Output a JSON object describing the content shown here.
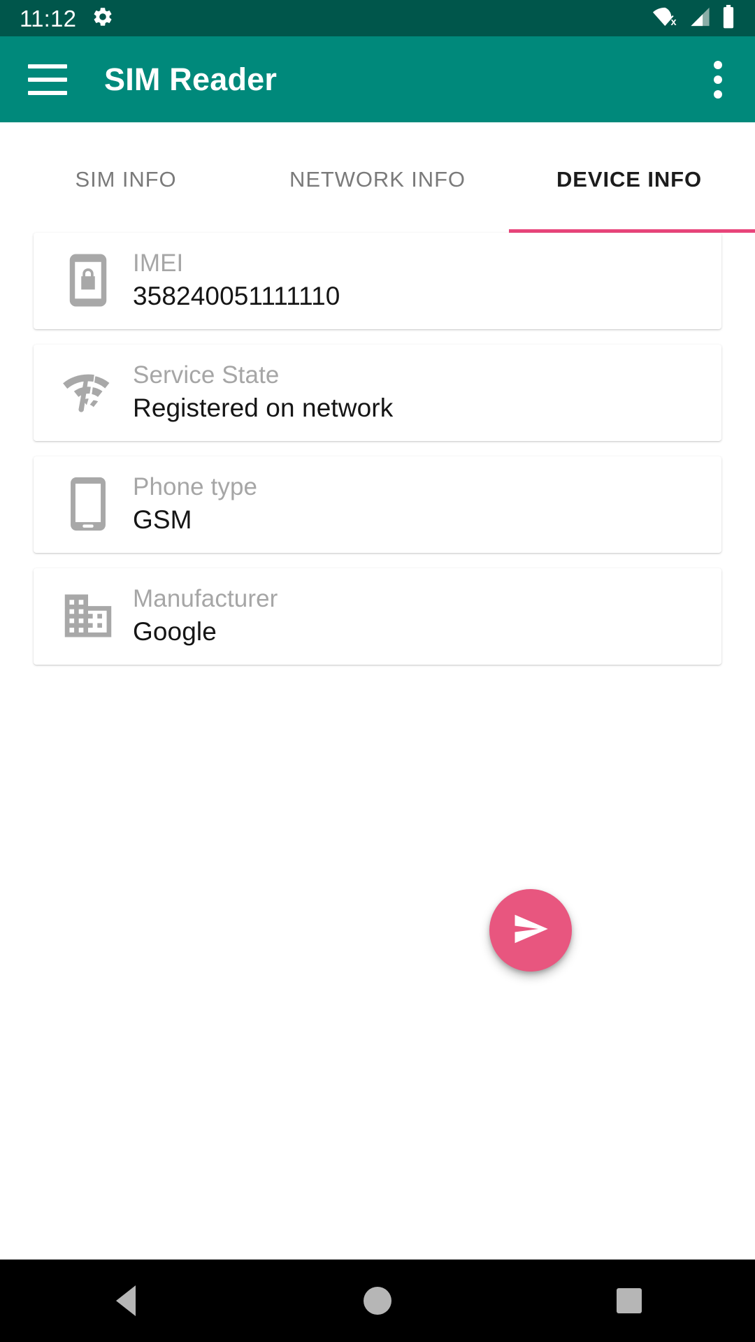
{
  "status_bar": {
    "time": "11:12",
    "icons": [
      "settings-gear-icon",
      "wifi-off-icon",
      "cellular-signal-icon",
      "battery-full-icon"
    ],
    "background_color": "#00564b"
  },
  "app_bar": {
    "title": "SIM Reader",
    "menu_icon": "hamburger-menu-icon",
    "overflow_icon": "more-vertical-icon",
    "background_color": "#00897b"
  },
  "tabs": {
    "items": [
      {
        "label": "SIM INFO",
        "active": false
      },
      {
        "label": "NETWORK INFO",
        "active": false
      },
      {
        "label": "DEVICE INFO",
        "active": true
      }
    ],
    "indicator_color": "#e8447a",
    "active_text_color": "#1c1c1c",
    "inactive_text_color": "#7a7a7a"
  },
  "device_info": {
    "rows": [
      {
        "icon": "phone-lock-icon",
        "label": "IMEI",
        "value": "358240051111110"
      },
      {
        "icon": "network-check-icon",
        "label": "Service State",
        "value": "Registered on network"
      },
      {
        "icon": "smartphone-icon",
        "label": "Phone type",
        "value": "GSM"
      },
      {
        "icon": "business-building-icon",
        "label": "Manufacturer",
        "value": "Google"
      }
    ]
  },
  "fab": {
    "icon": "send-icon",
    "color": "#e8567f"
  },
  "nav_bar": {
    "items": [
      {
        "name": "back",
        "icon": "triangle-back-icon"
      },
      {
        "name": "home",
        "icon": "circle-home-icon"
      },
      {
        "name": "recents",
        "icon": "square-recents-icon"
      }
    ],
    "background_color": "#000000"
  }
}
